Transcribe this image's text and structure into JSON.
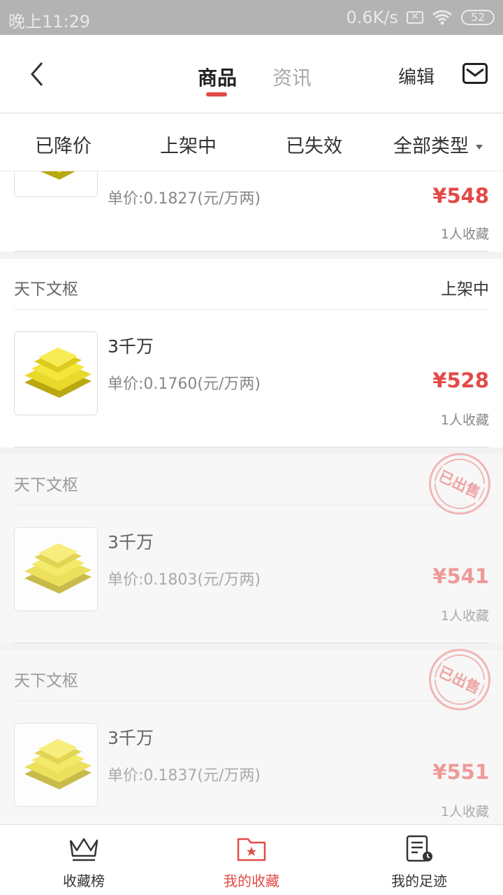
{
  "status_bar": {
    "time": "晚上11:29",
    "net_speed": "0.6K/s",
    "battery": "52"
  },
  "header": {
    "tabs": [
      {
        "label": "商品",
        "active": true
      },
      {
        "label": "资讯",
        "active": false
      }
    ],
    "edit_label": "编辑",
    "icons": {
      "back": "back-arrow-icon",
      "mail": "mail-icon"
    }
  },
  "filters": [
    "已降价",
    "上架中",
    "已失效",
    "全部类型"
  ],
  "items": [
    {
      "unit_price": "单价:0.1827(元/万两)",
      "price": "¥548",
      "favorites": "1人收藏",
      "sold": false
    },
    {
      "seller": "天下文枢",
      "status": "上架中",
      "name": "3千万",
      "unit_price": "单价:0.1760(元/万两)",
      "price": "¥528",
      "favorites": "1人收藏",
      "sold": false
    },
    {
      "seller": "天下文枢",
      "stamp": "已出售",
      "name": "3千万",
      "unit_price": "单价:0.1803(元/万两)",
      "price": "¥541",
      "favorites": "1人收藏",
      "sold": true
    },
    {
      "seller": "天下文枢",
      "stamp": "已出售",
      "name": "3千万",
      "unit_price": "单价:0.1837(元/万两)",
      "price": "¥551",
      "favorites": "1人收藏",
      "sold": true
    }
  ],
  "bottom_nav": [
    {
      "label": "收藏榜",
      "icon": "crown-icon",
      "active": false
    },
    {
      "label": "我的收藏",
      "icon": "star-folder-icon",
      "active": true
    },
    {
      "label": "我的足迹",
      "icon": "history-list-icon",
      "active": false
    }
  ],
  "colors": {
    "accent": "#e24a47",
    "statusbar": "#b3b3b3"
  }
}
